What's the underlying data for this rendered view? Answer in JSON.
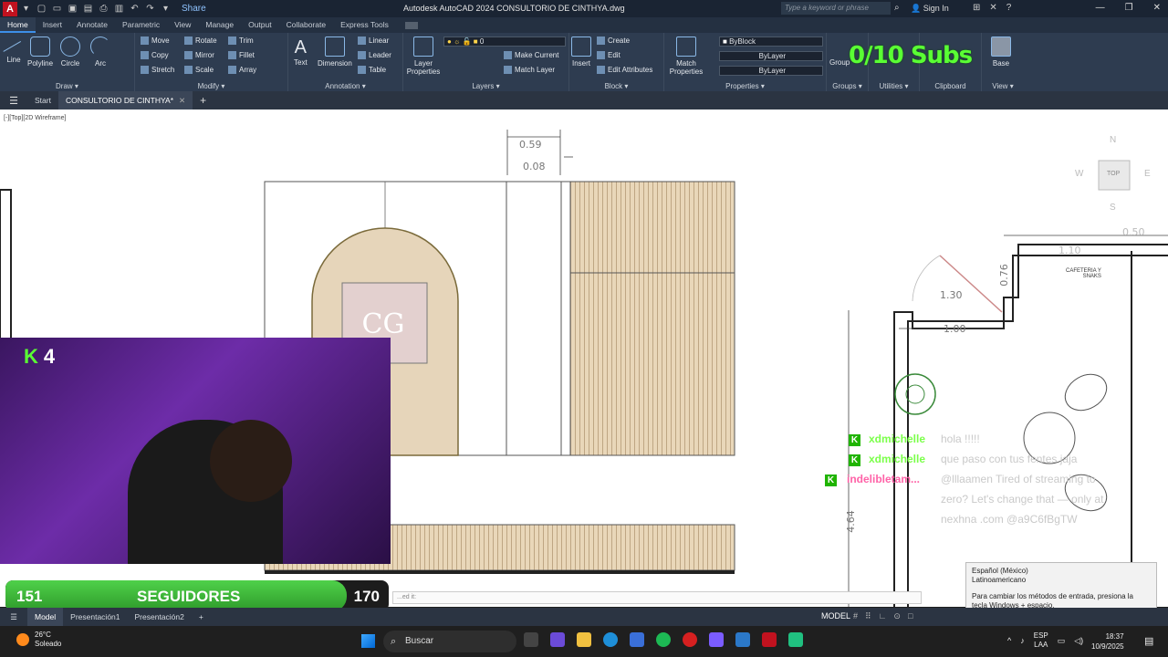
{
  "titlebar": {
    "title": "Autodesk AutoCAD 2024    CONSULTORIO DE CINTHYA.dwg",
    "share_label": "Share",
    "search_placeholder": "Type a keyword or phrase",
    "signin_label": "Sign In"
  },
  "ribbon_tabs": [
    "Home",
    "Insert",
    "Annotate",
    "Parametric",
    "View",
    "Manage",
    "Output",
    "Collaborate",
    "Express Tools"
  ],
  "draw_panel": {
    "title": "Draw",
    "tools": [
      "Line",
      "Polyline",
      "Circle",
      "Arc"
    ]
  },
  "modify_panel": {
    "title": "Modify",
    "tools": [
      "Move",
      "Rotate",
      "Trim",
      "Copy",
      "Mirror",
      "Fillet",
      "Stretch",
      "Scale",
      "Array"
    ]
  },
  "annotation_panel": {
    "title": "Annotation",
    "tools": [
      "Text",
      "Dimension",
      "Linear",
      "Leader",
      "Table"
    ]
  },
  "layers_panel": {
    "title": "Layers",
    "layer_props": "Layer Properties",
    "current_layer": "0",
    "make_current": "Make Current",
    "match_layer": "Match Layer"
  },
  "block_panel": {
    "title": "Block",
    "insert": "Insert",
    "tools": [
      "Create",
      "Edit",
      "Edit Attributes"
    ]
  },
  "properties_panel": {
    "title": "Properties",
    "match": "Match Properties",
    "color": "ByBlock",
    "linetype": "ByLayer",
    "lineweight": "ByLayer"
  },
  "other_panels": {
    "groups": "Groups",
    "group_tool": "Group",
    "utilities": "Utilities",
    "clipboard": "Clipboard",
    "view": "View",
    "base": "Base"
  },
  "subs_overlay": "0/10 Subs",
  "file_tabs": {
    "start": "Start",
    "current": "CONSULTORIO DE CINTHYA*"
  },
  "viewport": {
    "label": "[-][Top][2D Wireframe]",
    "dims": {
      "d059": "0.59",
      "d008": "0.08",
      "d130": "1.30",
      "d100": "1.00",
      "d076": "0.76",
      "d464": "4.64",
      "d110": "1.10",
      "d050": "0.50"
    },
    "room_label_line1": "CAFETERIA Y",
    "room_label_line2": "SNAKS",
    "viewcube": {
      "top": "TOP",
      "n": "N",
      "s": "S",
      "w": "W",
      "e": "E"
    },
    "monogram": "CG"
  },
  "webcam": {
    "badge_count": "4"
  },
  "chat": [
    {
      "user": "xdmichelle",
      "msg": "hola !!!!!"
    },
    {
      "user": "xdmichelle",
      "msg": "que paso con tus fentes jaja"
    },
    {
      "user": "indelibletam...",
      "msg": "@lllaamen Tired of streaming to zero? Let's change that — only at nexhna .com @a9C6fBgTW"
    }
  ],
  "followers": {
    "current": "151",
    "label": "SEGUIDORES",
    "goal": "170",
    "progress": 0.89
  },
  "ime_tooltip": {
    "lang_line1": "Español (México)",
    "lang_line2": "Latinoamericano",
    "tip": "Para cambiar los métodos de entrada, presiona la tecla Windows + espacio."
  },
  "command_line": "...ed it:",
  "layout_tabs": [
    "Model",
    "Presentación1",
    "Presentación2"
  ],
  "status_bar": {
    "model": "MODEL"
  },
  "taskbar": {
    "weather_temp": "26°C",
    "weather_desc": "Soleado",
    "search": "Buscar",
    "lang": "ESP",
    "lang2": "LAA",
    "time": "18:37",
    "date": "10/9/2025"
  },
  "colors": {
    "accent": "#3d8fe8",
    "subs_green": "#5aff34",
    "wood": "#e8d6b8",
    "arch_fill": "#e6d5ba",
    "bar_green": "#2e9a2a"
  }
}
